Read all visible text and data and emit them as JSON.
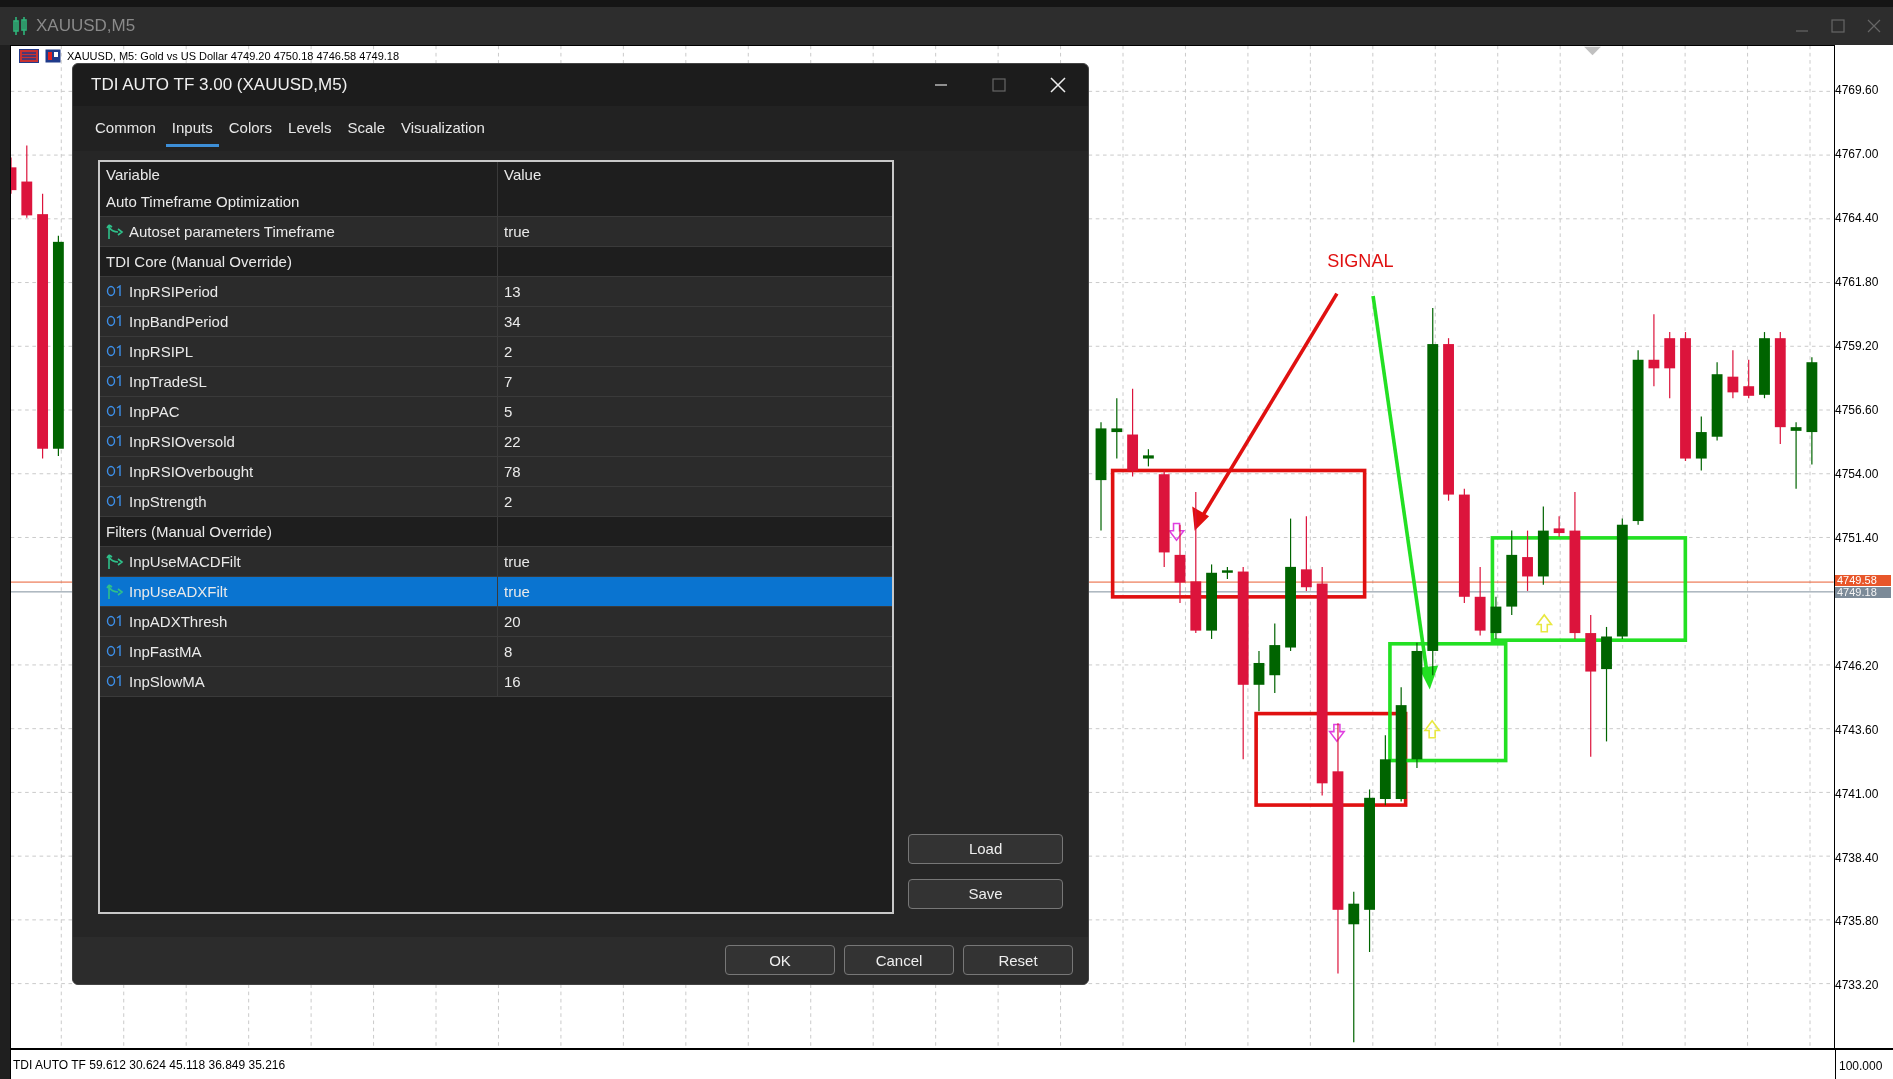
{
  "app": {
    "title": "XAUUSD,M5"
  },
  "chart": {
    "header": "XAUUSD, M5:  Gold vs US Dollar  4749.20 4750.18 4746.58 4749.18",
    "annotation": "SIGNAL",
    "chart_data": {
      "type": "candlestick",
      "ylim": [
        4730.57,
        4771.45
      ],
      "grid": true,
      "ref_lines": [
        {
          "axis": "y",
          "value": 4749.58,
          "label": "4749.58",
          "color": "#e8562a"
        },
        {
          "axis": "y",
          "value": 4749.18,
          "label": "4749.18",
          "color": "#7b8a98"
        }
      ],
      "yticks": [
        {
          "value": 4769.6,
          "label": "4769.60"
        },
        {
          "value": 4767.0,
          "label": "4767.00"
        },
        {
          "value": 4764.4,
          "label": "4764.40"
        },
        {
          "value": 4761.8,
          "label": "4761.80"
        },
        {
          "value": 4759.2,
          "label": "4759.20"
        },
        {
          "value": 4756.6,
          "label": "4756.60"
        },
        {
          "value": 4754.0,
          "label": "4754.00"
        },
        {
          "value": 4751.4,
          "label": "4751.40"
        },
        {
          "value": 4746.2,
          "label": "4746.20"
        },
        {
          "value": 4743.6,
          "label": "4743.60"
        },
        {
          "value": 4741.0,
          "label": "4741.00"
        },
        {
          "value": 4738.4,
          "label": "4738.40"
        },
        {
          "value": 4735.8,
          "label": "4735.80"
        },
        {
          "value": 4733.2,
          "label": "4733.20"
        }
      ],
      "categories": [
        null,
        null,
        null,
        null,
        null,
        null,
        null,
        null,
        null,
        null,
        null,
        null,
        null,
        null,
        null,
        null,
        null,
        null,
        null,
        null,
        null,
        null,
        null,
        null,
        null,
        null,
        null,
        null,
        null,
        null,
        null,
        null,
        null,
        null,
        null,
        null,
        null,
        null,
        null,
        null,
        null,
        null,
        null,
        null,
        null,
        null,
        null,
        null,
        null,
        null,
        null,
        null,
        null,
        null,
        null,
        null,
        null,
        null,
        null,
        null,
        null,
        null,
        null,
        null,
        null,
        null,
        null,
        null,
        null,
        null,
        null,
        null,
        null,
        null,
        null,
        null,
        null,
        null,
        null,
        null,
        null,
        null,
        null,
        null,
        null,
        null,
        null,
        null,
        null,
        null,
        null,
        null,
        null,
        null,
        null,
        null,
        null,
        null,
        null,
        null,
        null,
        null,
        null,
        null,
        null,
        null,
        null,
        null,
        null,
        null,
        null,
        null,
        null,
        null,
        null
      ],
      "ohlc": [
        [
          4766.5,
          4766.9,
          4765.42,
          4765.57
        ],
        [
          4765.92,
          4767.39,
          4764.44,
          4764.54
        ],
        [
          4764.59,
          4765.42,
          4754.62,
          4755.02
        ],
        [
          4755.02,
          4763.71,
          4754.72,
          4763.46
        ],
        null,
        null,
        null,
        null,
        null,
        null,
        null,
        null,
        null,
        null,
        null,
        null,
        null,
        null,
        null,
        null,
        null,
        null,
        null,
        null,
        null,
        null,
        null,
        null,
        null,
        null,
        null,
        null,
        null,
        null,
        null,
        null,
        null,
        null,
        null,
        null,
        null,
        null,
        null,
        null,
        null,
        null,
        null,
        null,
        null,
        null,
        null,
        null,
        null,
        null,
        null,
        null,
        null,
        null,
        null,
        null,
        null,
        null,
        null,
        null,
        null,
        null,
        null,
        null,
        null,
        [
          4753.74,
          4756.1,
          4751.68,
          4755.85
        ],
        [
          4755.7,
          4757.08,
          4754.62,
          4755.85
        ],
        [
          4755.6,
          4757.47,
          4753.89,
          4754.13
        ],
        [
          4754.62,
          4755.0,
          4754.3,
          4754.75
        ],
        [
          4753.98,
          4754.13,
          4750.2,
          4750.79
        ],
        [
          4750.69,
          4751.92,
          4748.73,
          4749.56
        ],
        [
          4749.61,
          4753.25,
          4747.5,
          4747.6
        ],
        [
          4747.6,
          4750.3,
          4747.26,
          4749.96
        ],
        [
          4749.96,
          4750.2,
          4749.71,
          4750.06
        ],
        [
          4750.01,
          4750.2,
          4742.35,
          4745.39
        ],
        [
          4745.39,
          4746.77,
          4744.31,
          4746.28
        ],
        [
          4745.78,
          4747.89,
          4745.05,
          4747.01
        ],
        [
          4746.91,
          4752.17,
          4746.77,
          4750.2
        ],
        [
          4750.1,
          4752.27,
          4749.22,
          4749.37
        ],
        [
          4749.52,
          4750.2,
          4740.87,
          4741.37
        ],
        [
          4741.86,
          4743.82,
          4733.61,
          4736.21
        ],
        [
          4735.62,
          4736.95,
          4730.81,
          4736.46
        ],
        [
          4736.21,
          4741.12,
          4734.49,
          4740.78
        ],
        [
          4740.73,
          4743.33,
          4740.48,
          4742.35
        ],
        [
          4740.73,
          4745.29,
          4740.63,
          4744.56
        ],
        [
          4742.35,
          4747.11,
          4742.0,
          4746.77
        ],
        [
          4746.77,
          4760.76,
          4745.78,
          4759.29
        ],
        [
          4759.29,
          4759.53,
          4752.9,
          4753.15
        ],
        [
          4753.15,
          4753.39,
          4748.73,
          4748.98
        ],
        [
          4748.98,
          4750.2,
          4747.4,
          4747.6
        ],
        [
          4747.5,
          4748.98,
          4747.26,
          4748.58
        ],
        [
          4748.58,
          4751.68,
          4748.24,
          4750.69
        ],
        [
          4750.6,
          4751.68,
          4749.22,
          4749.81
        ],
        [
          4749.81,
          4752.66,
          4749.47,
          4751.68
        ],
        [
          4751.77,
          4752.27,
          4751.43,
          4751.58
        ],
        [
          4751.68,
          4753.25,
          4747.26,
          4747.5
        ],
        [
          4747.5,
          4748.24,
          4742.45,
          4745.93
        ],
        [
          4746.03,
          4747.75,
          4743.08,
          4747.36
        ],
        [
          4747.36,
          4752.17,
          4747.26,
          4751.92
        ],
        [
          4752.07,
          4759.04,
          4751.92,
          4758.65
        ],
        [
          4758.65,
          4760.51,
          4757.57,
          4758.3
        ],
        [
          4759.53,
          4759.78,
          4757.08,
          4758.3
        ],
        [
          4759.53,
          4759.78,
          4754.52,
          4754.62
        ],
        [
          4754.62,
          4756.34,
          4754.13,
          4755.7
        ],
        [
          4755.51,
          4758.55,
          4755.36,
          4758.06
        ],
        [
          4757.96,
          4759.04,
          4757.08,
          4757.32
        ],
        [
          4757.57,
          4758.65,
          4757.08,
          4757.18
        ],
        [
          4757.22,
          4759.78,
          4757.08,
          4759.53
        ],
        [
          4759.53,
          4759.78,
          4755.21,
          4755.9
        ],
        [
          4755.75,
          4756.1,
          4753.39,
          4755.9
        ],
        [
          4755.7,
          4758.75,
          4754.38,
          4758.55
        ]
      ]
    }
  },
  "indicator_window": {
    "label": "TDI AUTO TF 59.612 30.624 45.118 36.849 35.216",
    "scale": "100.000"
  },
  "dialog": {
    "title": "TDI AUTO TF 3.00 (XAUUSD,M5)",
    "tabs": [
      {
        "label": "Common",
        "selected": false
      },
      {
        "label": "Inputs",
        "selected": true
      },
      {
        "label": "Colors",
        "selected": false
      },
      {
        "label": "Levels",
        "selected": false
      },
      {
        "label": "Scale",
        "selected": false
      },
      {
        "label": "Visualization",
        "selected": false
      }
    ],
    "table": {
      "columns": [
        "Variable",
        "Value"
      ],
      "rows": [
        {
          "kind": "group",
          "variable": "Auto Timeframe Optimization",
          "selected": false
        },
        {
          "kind": "bool",
          "variable": "Autoset parameters Timeframe",
          "value": "true",
          "selected": false
        },
        {
          "kind": "group",
          "variable": "TDI Core (Manual Override)",
          "selected": false
        },
        {
          "kind": "int",
          "variable": "InpRSIPeriod",
          "value": "13",
          "selected": false
        },
        {
          "kind": "int",
          "variable": "InpBandPeriod",
          "value": "34",
          "selected": false
        },
        {
          "kind": "int",
          "variable": "InpRSIPL",
          "value": "2",
          "selected": false
        },
        {
          "kind": "int",
          "variable": "InpTradeSL",
          "value": "7",
          "selected": false
        },
        {
          "kind": "int",
          "variable": "InpPAC",
          "value": "5",
          "selected": false
        },
        {
          "kind": "int",
          "variable": "InpRSIOversold",
          "value": "22",
          "selected": false
        },
        {
          "kind": "int",
          "variable": "InpRSIOverbought",
          "value": "78",
          "selected": false
        },
        {
          "kind": "int",
          "variable": "InpStrength",
          "value": "2",
          "selected": false
        },
        {
          "kind": "group",
          "variable": "Filters (Manual Override)",
          "selected": false
        },
        {
          "kind": "bool",
          "variable": "InpUseMACDFilt",
          "value": "true",
          "selected": false
        },
        {
          "kind": "bool",
          "variable": "InpUseADXFilt",
          "value": "true",
          "selected": true
        },
        {
          "kind": "int",
          "variable": "InpADXThresh",
          "value": "20",
          "selected": false
        },
        {
          "kind": "int",
          "variable": "InpFastMA",
          "value": "8",
          "selected": false
        },
        {
          "kind": "int",
          "variable": "InpSlowMA",
          "value": "16",
          "selected": false
        }
      ]
    },
    "side_buttons": [
      "Load",
      "Save"
    ],
    "buttons": [
      "OK",
      "Cancel",
      "Reset"
    ]
  }
}
